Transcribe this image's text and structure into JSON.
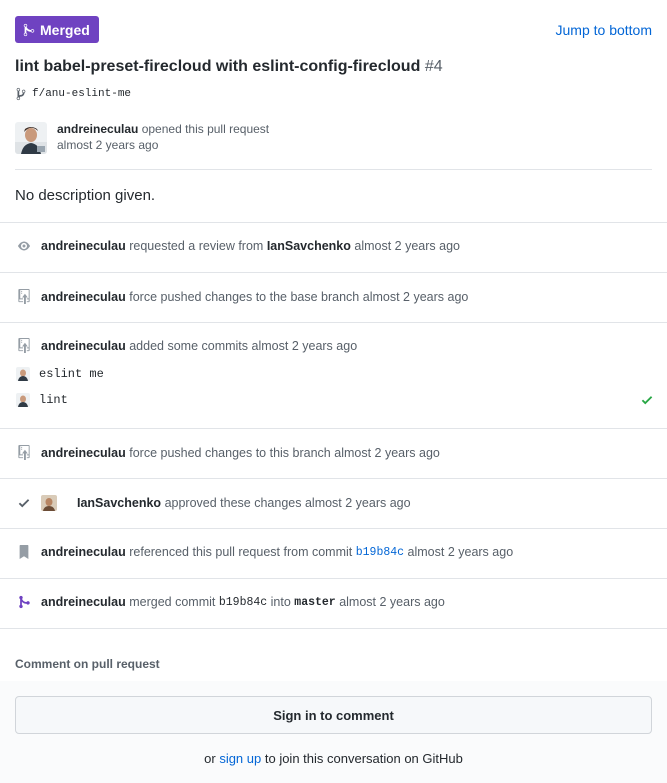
{
  "header": {
    "badge_label": "Merged",
    "jump_link": "Jump to bottom",
    "title": "lint babel-preset-firecloud with eslint-config-firecloud",
    "number": "#4",
    "branch": "f/anu-eslint-me",
    "opened_author": "andreineculau",
    "opened_text": "opened this pull request",
    "opened_time": "almost 2 years ago",
    "description": "No description given."
  },
  "timeline": [
    {
      "icon": "eye-icon",
      "author": "andreineculau",
      "text": "requested a review from",
      "target": "IanSavchenko",
      "time": "almost 2 years ago"
    },
    {
      "icon": "repo-push-icon",
      "author": "andreineculau",
      "text": "force pushed changes to the base branch",
      "time": "almost 2 years ago"
    },
    {
      "icon": "repo-push-icon",
      "author": "andreineculau",
      "text": "added some commits",
      "time": "almost 2 years ago",
      "commits": [
        {
          "message": "eslint me"
        },
        {
          "message": "lint"
        }
      ]
    },
    {
      "icon": "repo-push-icon",
      "author": "andreineculau",
      "text": "force pushed changes to this branch",
      "time": "almost 2 years ago"
    },
    {
      "icon": "check-icon",
      "author": "IanSavchenko",
      "text": "approved these changes",
      "time": "almost 2 years ago"
    },
    {
      "icon": "bookmark-icon",
      "author": "andreineculau",
      "text": "referenced this pull request from commit",
      "sha": "b19b84c",
      "time": "almost 2 years ago"
    },
    {
      "icon": "merge-icon",
      "author": "andreineculau",
      "text": "merged commit",
      "sha": "b19b84c",
      "into": "into",
      "branch": "master",
      "time": "almost 2 years ago"
    }
  ],
  "comment": {
    "label": "Comment on pull request",
    "signin_button": "Sign in to comment",
    "or_text": "or",
    "signup_link": "sign up",
    "signup_suffix": "to join this conversation on GitHub"
  },
  "colors": {
    "merged": "#6f42c1",
    "link": "#0366d6",
    "check": "#28a745"
  }
}
